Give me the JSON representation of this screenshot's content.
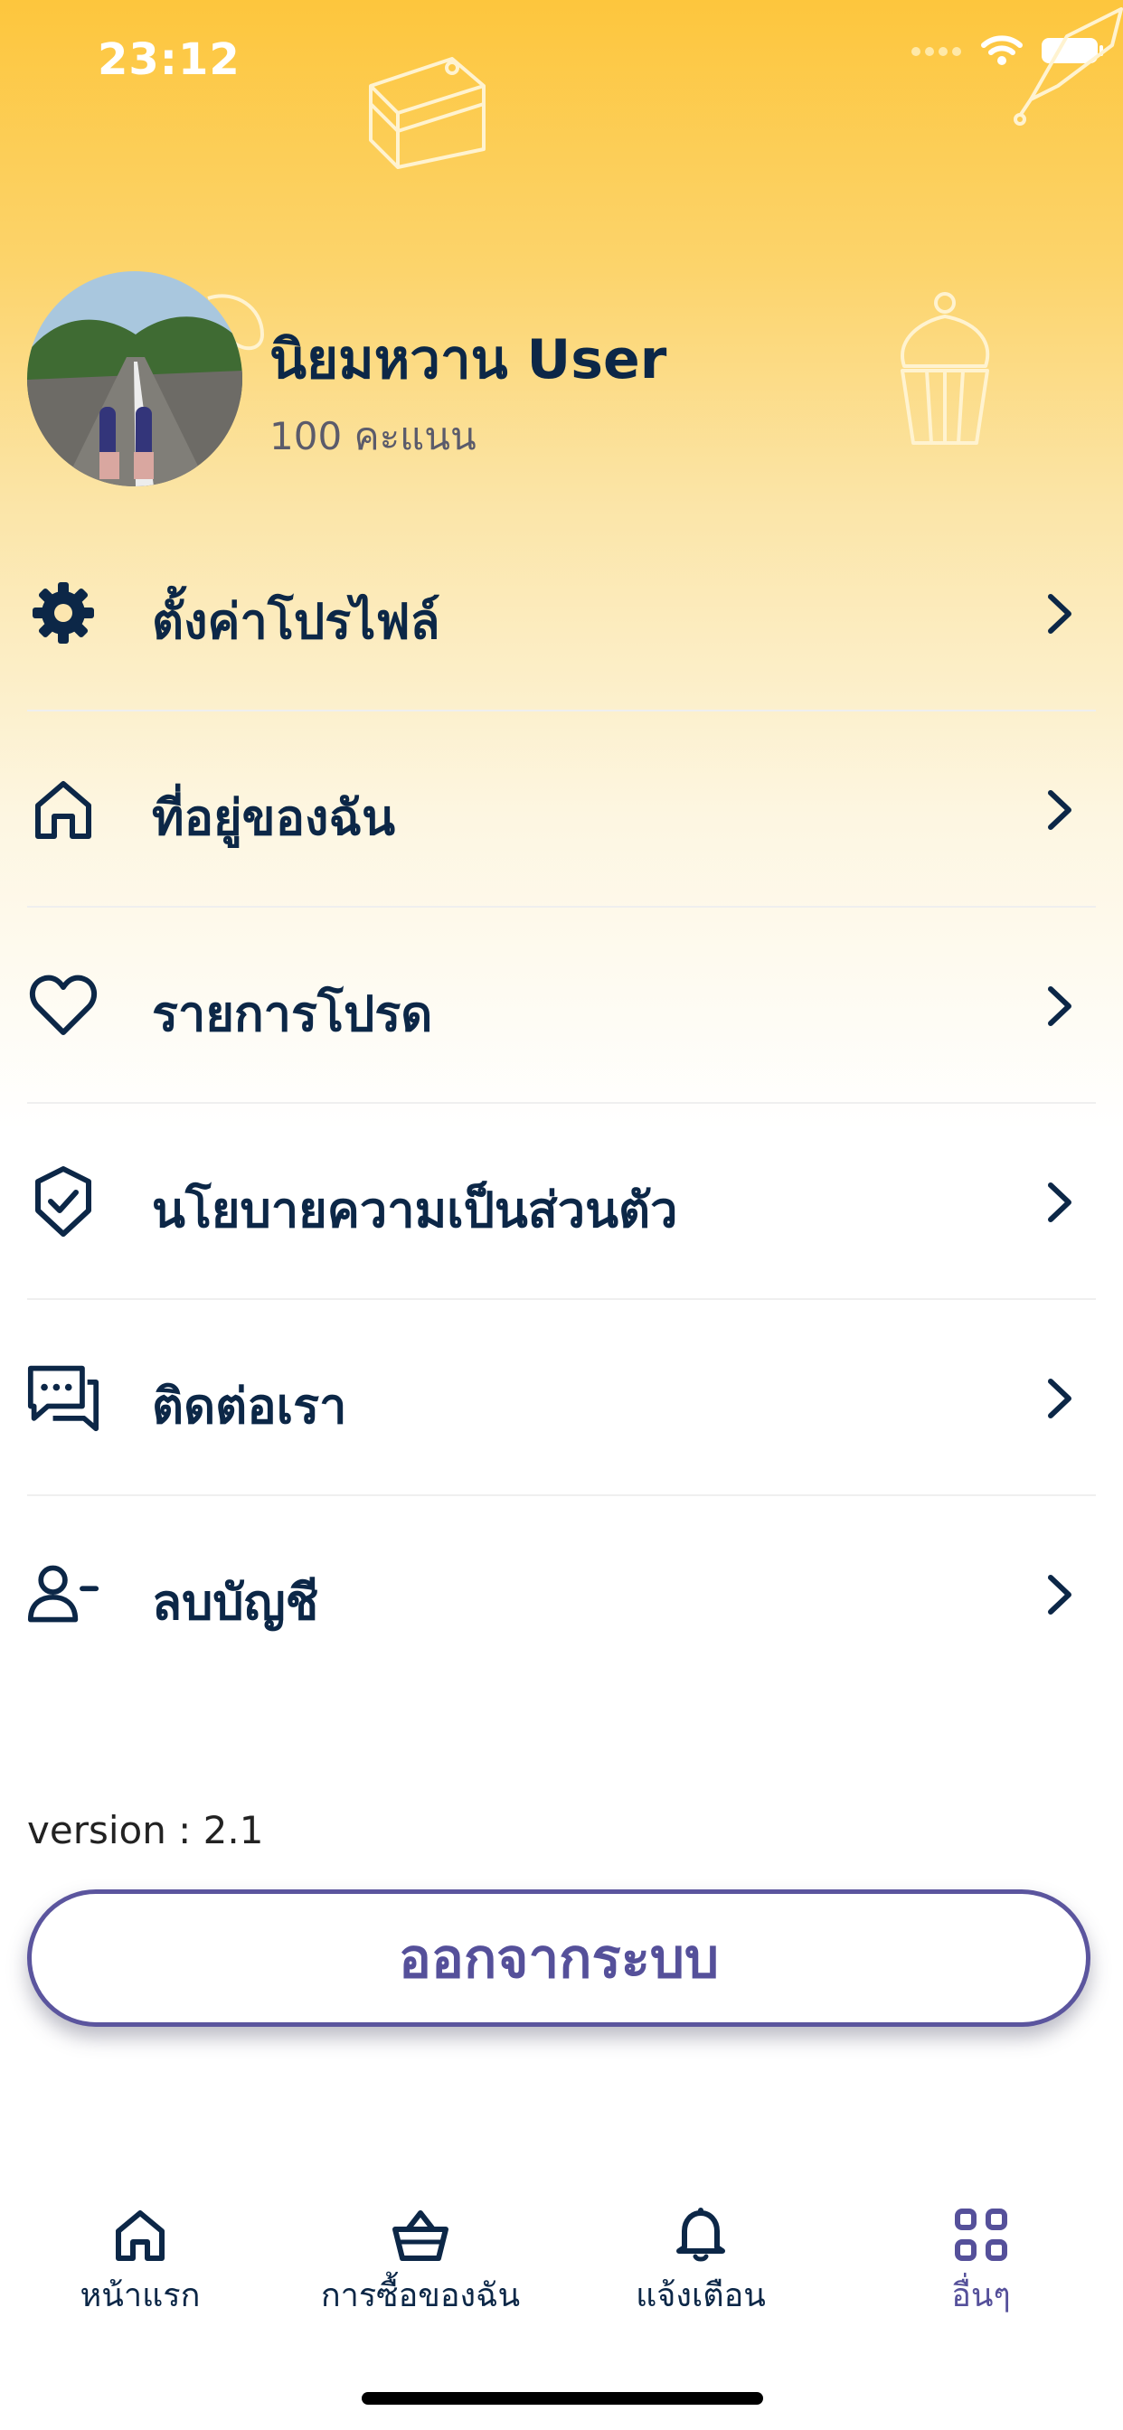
{
  "status_bar": {
    "time": "23:12",
    "icons": [
      "signal-dots-icon",
      "wifi-icon",
      "battery-icon"
    ]
  },
  "profile": {
    "name": "นิยมหวาน User",
    "points": "100 คะแนน"
  },
  "menu": [
    {
      "label": "ตั้งค่าโปรไฟล์",
      "icon": "gear-icon"
    },
    {
      "label": "ที่อยู่ของฉัน",
      "icon": "home-icon"
    },
    {
      "label": "รายการโปรด",
      "icon": "heart-icon"
    },
    {
      "label": "นโยบายความเป็นส่วนตัว",
      "icon": "shield-check-icon"
    },
    {
      "label": "ติดต่อเรา",
      "icon": "chat-icon"
    },
    {
      "label": "ลบบัญชี",
      "icon": "user-minus-icon"
    }
  ],
  "version": "version : 2.1",
  "logout_label": "ออกจากระบบ",
  "tabs": [
    {
      "label": "หน้าแรก",
      "icon": "home-icon"
    },
    {
      "label": "การซื้อของฉัน",
      "icon": "basket-icon"
    },
    {
      "label": "แจ้งเตือน",
      "icon": "bell-icon"
    },
    {
      "label": "อื่นๆ",
      "icon": "grid-icon",
      "active": true
    }
  ],
  "colors": {
    "primary": "#0C2747",
    "accent": "#55509A",
    "header_yellow": "#FDC63D"
  }
}
